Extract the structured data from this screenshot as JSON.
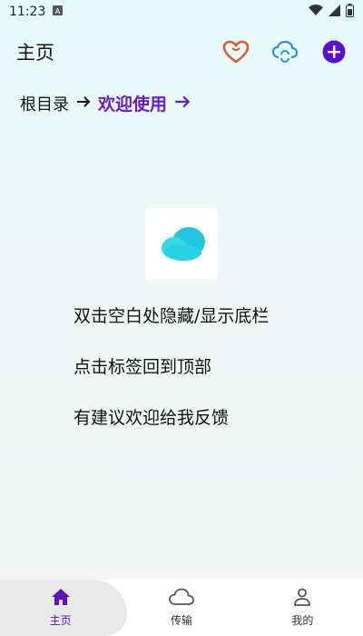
{
  "status_bar": {
    "time": "11:23",
    "notification_icon": "a-icon",
    "icons": [
      "wifi-icon",
      "signal-icon",
      "battery-icon"
    ]
  },
  "header": {
    "title": "主页",
    "actions": [
      "heart-icon",
      "cloud-sync-icon",
      "add-icon"
    ],
    "accent": "#6a1bd9"
  },
  "breadcrumb": {
    "root_label": "根目录",
    "current_label": "欢迎使用"
  },
  "main": {
    "tips": [
      "双击空白处隐藏/显示底栏",
      "点击标签回到顶部",
      "有建议欢迎给我反馈"
    ]
  },
  "bottom_nav": {
    "items": [
      {
        "label": "主页",
        "icon": "home-icon"
      },
      {
        "label": "传输",
        "icon": "cloud-icon"
      },
      {
        "label": "我的",
        "icon": "person-icon"
      }
    ],
    "active_index": 0
  }
}
